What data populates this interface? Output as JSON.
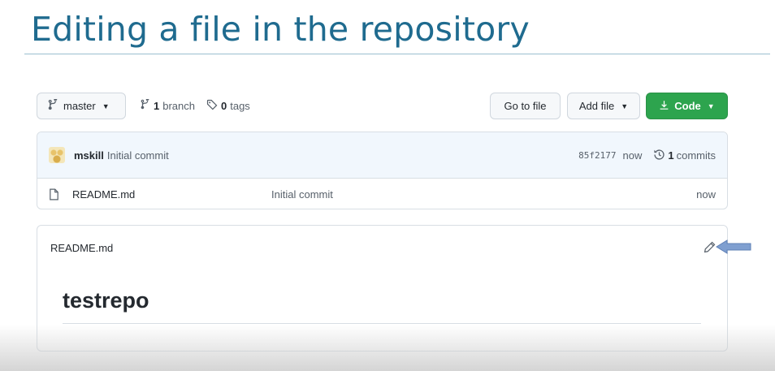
{
  "slide": {
    "title": "Editing a file in the repository"
  },
  "toolbar": {
    "branch_label": "master",
    "branch_count": "1",
    "branch_word": "branch",
    "tag_count": "0",
    "tag_word": "tags",
    "go_to_file": "Go to file",
    "add_file": "Add file",
    "code": "Code"
  },
  "commit": {
    "author": "mskill",
    "message": "Initial commit",
    "sha": "85f2177",
    "age": "now",
    "commit_count": "1",
    "commit_word": "commits"
  },
  "files": [
    {
      "name": "README.md",
      "commit_message": "Initial commit",
      "age": "now"
    }
  ],
  "readme": {
    "filename": "README.md",
    "heading": "testrepo"
  },
  "colors": {
    "title": "#1f6b8f",
    "code_button": "#2da44e",
    "commit_row_bg": "#f1f7fd",
    "pointer_arrow": "#7f9fd0"
  },
  "icons": [
    "branch-icon",
    "tag-icon",
    "download-icon",
    "history-icon",
    "file-icon",
    "pencil-icon",
    "pointer-arrow"
  ]
}
